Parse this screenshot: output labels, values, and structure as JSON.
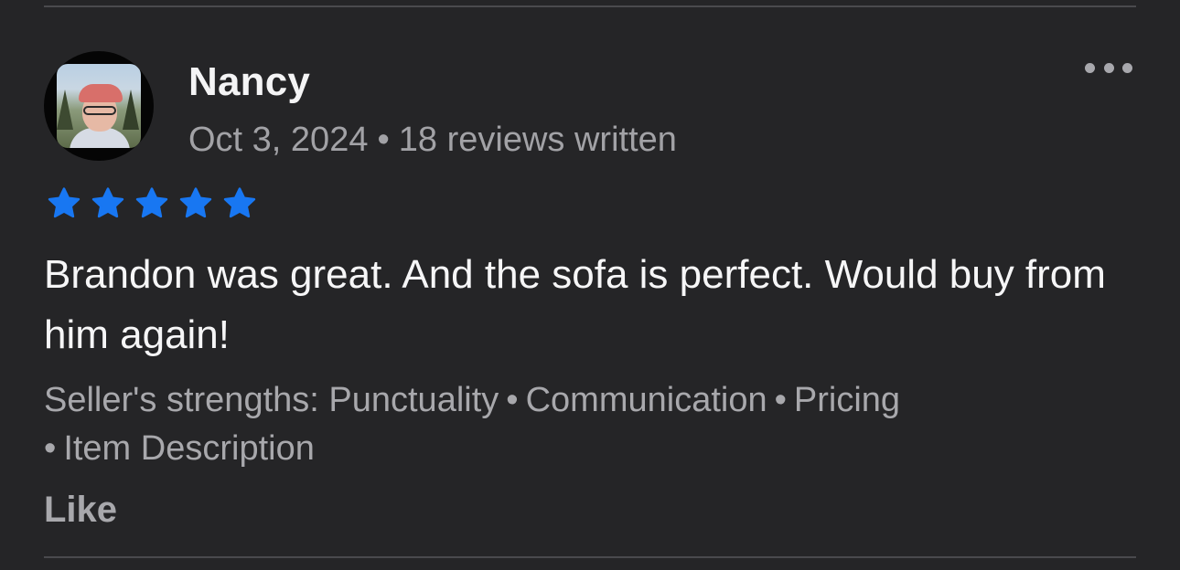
{
  "review": {
    "author": "Nancy",
    "date": "Oct 3, 2024",
    "separator": "•",
    "reviews_written": "18 reviews written",
    "rating": 5,
    "rating_max": 5,
    "star_icon": "star-icon",
    "text": "Brandon was great. And the sofa is perfect. Would buy from him again!",
    "strengths_label": "Seller's strengths:",
    "strengths": [
      "Punctuality",
      "Communication",
      "Pricing",
      "Item Description"
    ],
    "like_label": "Like",
    "more_icon": "more-options-icon"
  },
  "colors": {
    "background": "#252527",
    "star": "#1877F2",
    "primary_text": "#F6F6F7",
    "secondary_text": "#A8A8AC",
    "divider": "#4A4A4D"
  }
}
